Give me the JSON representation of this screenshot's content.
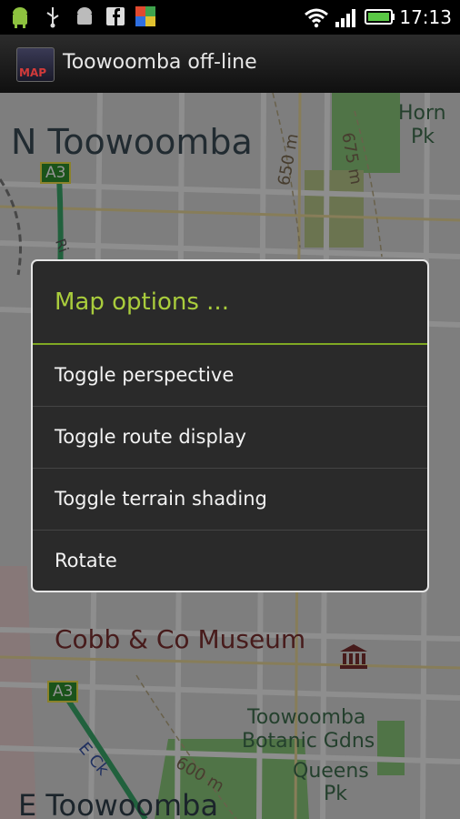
{
  "status_bar": {
    "time": "17:13",
    "icons": [
      "android-icon",
      "usb-icon",
      "android-debug-icon",
      "facebook-icon",
      "app-notification-icon",
      "wifi-icon",
      "signal-icon",
      "battery-icon"
    ]
  },
  "app": {
    "title": "Toowoomba off-line",
    "icon_text": "MAP"
  },
  "map": {
    "labels": {
      "n_toowoomba": "N Toowoomba",
      "horn_pk_1": "Horn",
      "horn_pk_2": "Pk",
      "a3_top": "A3",
      "a3_bottom": "A3",
      "contour_650": "650 m",
      "contour_675": "675 m",
      "road_ri": "Ri",
      "cobb_museum": "Cobb & Co Museum",
      "botanic_1": "Toowoomba",
      "botanic_2": "Botanic Gdns",
      "queens_1": "Queens",
      "queens_2": "Pk",
      "contour_600": "600 m",
      "road_eck": "E Ck",
      "e_toowoomba": "E Toowoomba"
    },
    "colors": {
      "background": "#d9d9d9",
      "park": "#8bc97a",
      "road": "#f4f4f4",
      "highway": "#3aa86a"
    }
  },
  "dialog": {
    "title": "Map options ...",
    "items": [
      {
        "label": "Toggle perspective"
      },
      {
        "label": "Toggle route display"
      },
      {
        "label": "Toggle terrain shading"
      },
      {
        "label": "Rotate"
      }
    ],
    "colors": {
      "title": "#a9cc3c",
      "divider": "#7fa823",
      "background": "#2a2a2a"
    }
  }
}
